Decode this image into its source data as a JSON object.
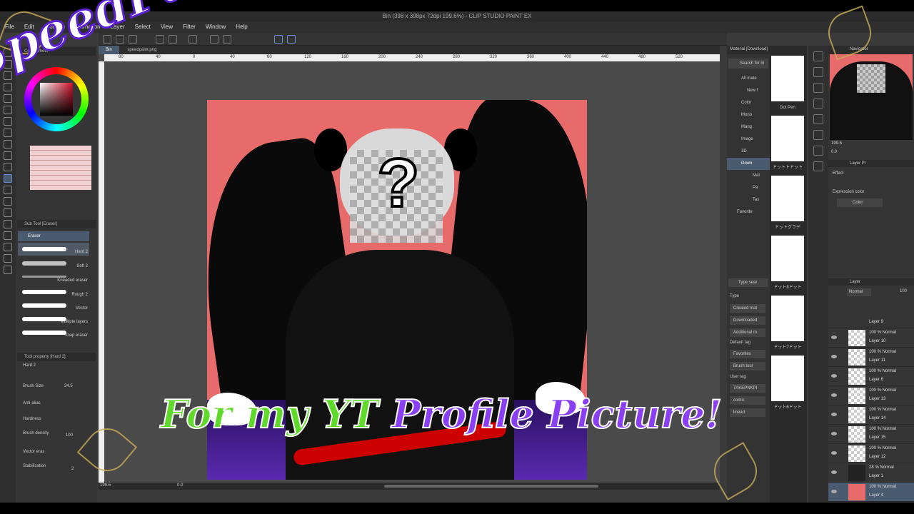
{
  "window": {
    "title": "Bin (398 x 398px 72dpi 199.6%) - CLIP STUDIO PAINT EX"
  },
  "menu": [
    "File",
    "Edit",
    "Story(P)",
    "Animation",
    "Layer",
    "Select",
    "View",
    "Filter",
    "Window",
    "Help"
  ],
  "tabs": [
    "Bin",
    "speedpaint.png"
  ],
  "ruler": [
    "80",
    "40",
    "0",
    "40",
    "80",
    "120",
    "160",
    "200",
    "240",
    "280",
    "320",
    "360",
    "400",
    "440",
    "480",
    "520"
  ],
  "left_panel": {
    "color_wheel_title": "Color Wheel",
    "subtool_title": "Sub Tool [Eraser]",
    "group": "Eraser",
    "subtools": [
      "Hard 2",
      "Soft 2",
      "Kneaded eraser",
      "Rough 2",
      "Vector",
      "Multiple layers",
      "Snap eraser"
    ],
    "tool_property_title": "Tool property [Hard 2]",
    "tool_property_name": "Hard 2",
    "brush_size_label": "Brush Size",
    "brush_size_value": "34.5",
    "anti_alias_label": "Anti-alias",
    "hardness_label": "Hardness",
    "brush_density_label": "Brush density",
    "brush_density_value": "100",
    "vector_label": "Vector eras",
    "stabilization_label": "Stabilization",
    "stabilization_value": "2"
  },
  "status": {
    "zoom": "199.6",
    "angle": "0.0"
  },
  "material": {
    "title": "Material [Download]",
    "search": "Search for m",
    "tree": [
      "All mate",
      "New f",
      "Color",
      "Mono",
      "Mang",
      "Image",
      "3D",
      "Down",
      "Mat",
      "Pa",
      "Tax",
      "Favorite"
    ],
    "search_placeholder": "Type sear",
    "type_label": "Type",
    "type_buttons": [
      "Created mat",
      "Downloaded",
      "Additional m"
    ],
    "default_tag_label": "Default tag",
    "default_tags": [
      "Favorites",
      "Brush tool"
    ],
    "user_tag_label": "User tag",
    "user_tags": [
      "TAKEPNKPI",
      "comic",
      "lineart"
    ],
    "thumbs": [
      "Dot Pen",
      "ドットトドット",
      "ドットグラデ",
      "ドット8ドット",
      "ドット7ドット",
      "ドット6ドット"
    ]
  },
  "right_panel": {
    "navigator_title": "Navigator",
    "nav_zoom": "199.6",
    "nav_angle": "0.0",
    "layer_prop_title": "Layer Pr",
    "effect_label": "Effect",
    "expression_label": "Expression color",
    "expression_value": "Color",
    "layer_title": "Layer",
    "blend_mode": "Normal",
    "opacity": "100",
    "layers": [
      {
        "mode": "",
        "name": "Layer 9"
      },
      {
        "mode": "100 % Normal",
        "name": "Layer 10"
      },
      {
        "mode": "100 % Normal",
        "name": "Layer 11"
      },
      {
        "mode": "100 % Normal",
        "name": "Layer 6"
      },
      {
        "mode": "100 % Normal",
        "name": "Layer 13"
      },
      {
        "mode": "100 % Normal",
        "name": "Layer 14"
      },
      {
        "mode": "100 % Normal",
        "name": "Layer 15"
      },
      {
        "mode": "100 % Normal",
        "name": "Layer 12"
      },
      {
        "mode": "28 % Normal",
        "name": "Layer 1"
      },
      {
        "mode": "100 % Normal",
        "name": "Layer 4"
      }
    ]
  },
  "overlay": {
    "title": "SpeedPaint!",
    "subtitle_green": "For my YT",
    "subtitle_purple": "Profile Picture!"
  },
  "colors": {
    "art_bg": "#e86b6b",
    "title_stroke": "#5a1fd0",
    "green": "#5fd92a",
    "purple": "#8a3ff5"
  }
}
